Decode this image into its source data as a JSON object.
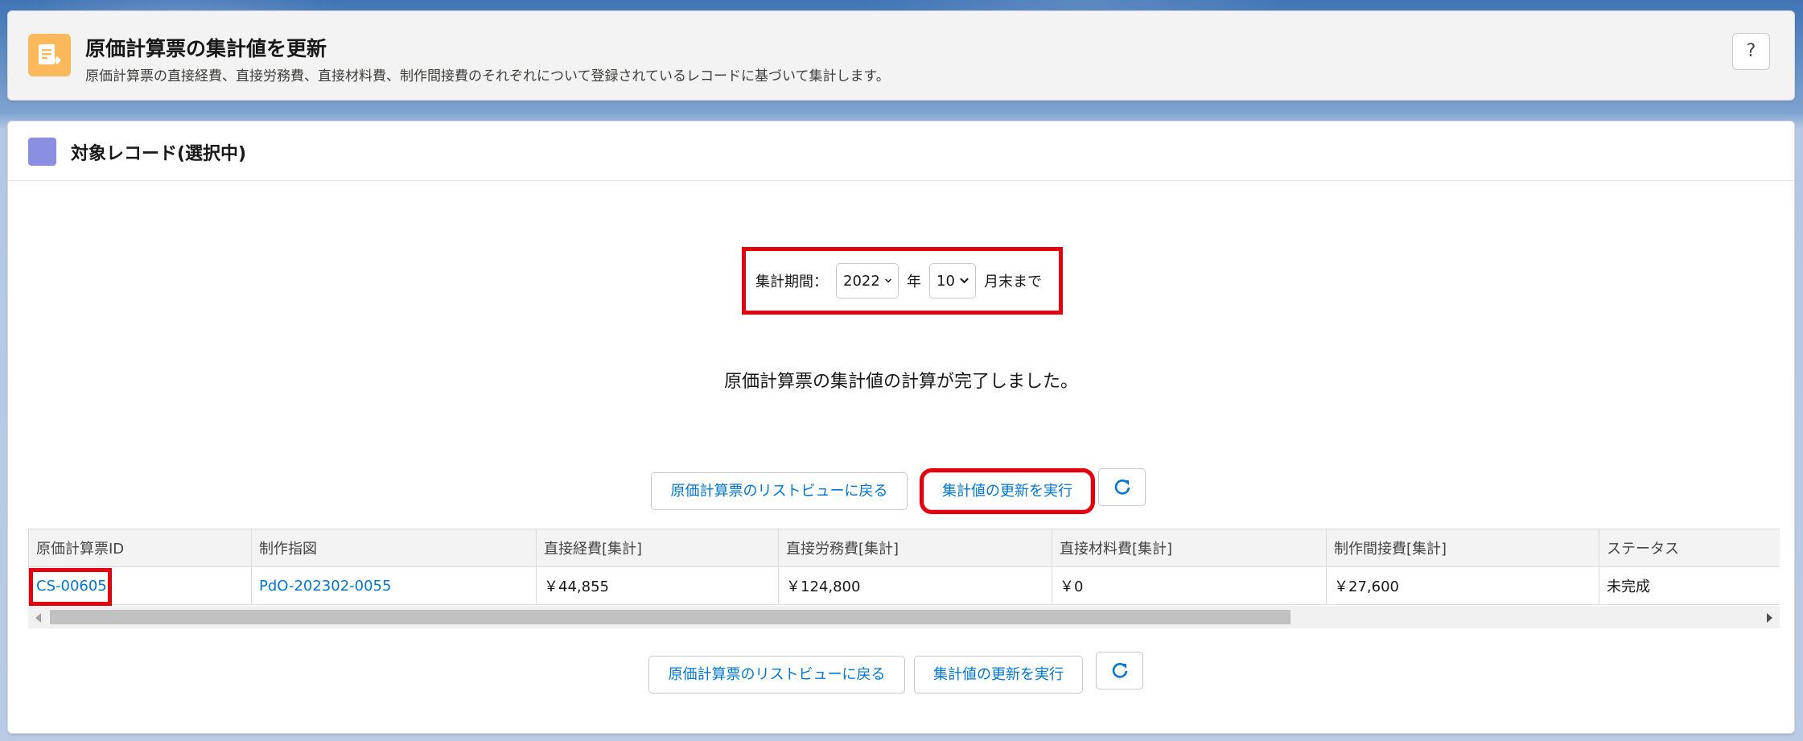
{
  "header": {
    "title": "原価計算票の集計値を更新",
    "description": "原価計算票の直接経費、直接労務費、直接材料費、制作間接費のそれぞれについて登録されているレコードに基づいて集計します。",
    "help_label": "?"
  },
  "card": {
    "title": "対象レコード(選択中)"
  },
  "period": {
    "label": "集計期間：",
    "year": "2022",
    "year_unit": "年",
    "month": "10",
    "month_suffix": "月末まで"
  },
  "message": "原価計算票の集計値の計算が完了しました。",
  "buttons": {
    "back_to_list": "原価計算票のリストビューに戻る",
    "run_update": "集計値の更新を実行"
  },
  "table": {
    "columns": [
      "原価計算票ID",
      "制作指図",
      "直接経費[集計]",
      "直接労務費[集計]",
      "直接材料費[集計]",
      "制作間接費[集計]",
      "ステータス"
    ],
    "rows": [
      [
        "CS-00605",
        "PdO-202302-0055",
        "￥44,855",
        "￥124,800",
        "￥0",
        "￥27,600",
        "未完成"
      ]
    ]
  },
  "colors": {
    "accent": "#0176d3",
    "highlight": "#e3000f",
    "header_icon": "#fcb95b",
    "card_icon": "#8a8fe1"
  }
}
